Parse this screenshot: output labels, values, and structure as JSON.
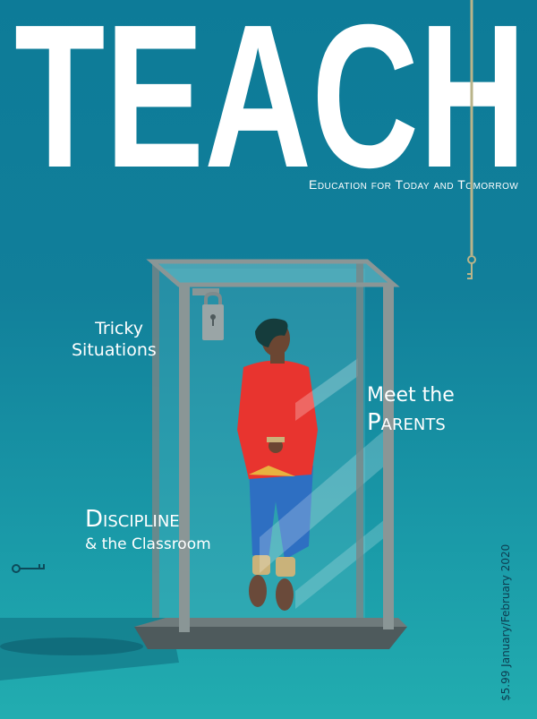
{
  "magazine": {
    "title": "TEACH",
    "tagline": "Education for Today and Tomorrow",
    "price": "$5.99",
    "issue_date": "January/February 2020"
  },
  "cover_lines": {
    "tricky_line1": "Tricky",
    "tricky_line2": "Situations",
    "parents_line1": "Meet the",
    "parents_line2": "Parents",
    "discipline": "Discipline",
    "classroom": "& the Classroom"
  },
  "colors": {
    "background_top": "#0d7b98",
    "background_bottom": "#22adb0",
    "masthead": "#ffffff",
    "jacket": "#e8342f",
    "pants": "#2e6fc2"
  },
  "icons": [
    "padlock-icon",
    "key-icon"
  ]
}
